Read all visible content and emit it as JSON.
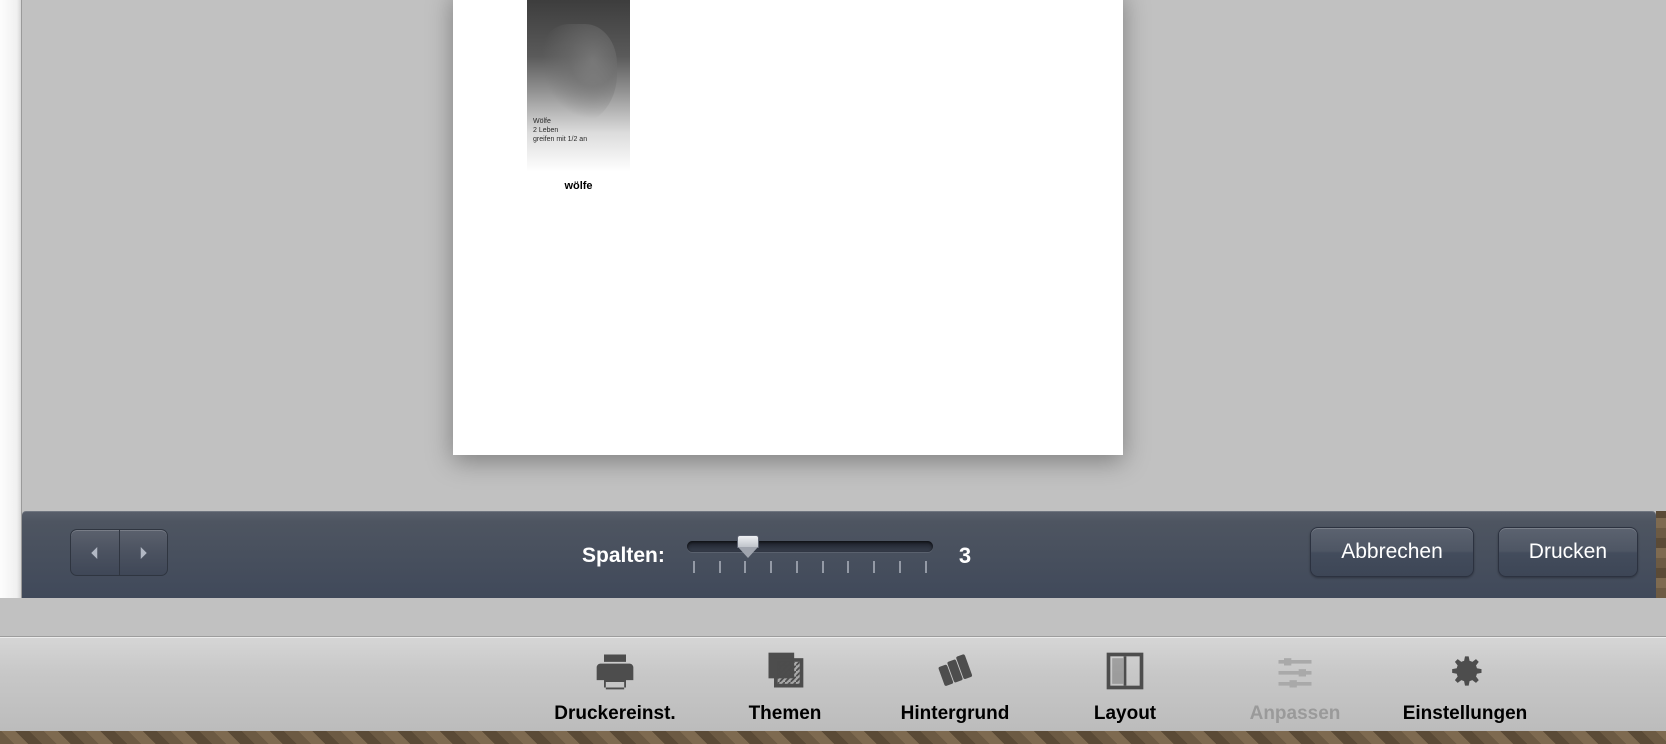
{
  "card": {
    "title": "Wölfe",
    "line2": "2 Leben",
    "line3": "greifen mit 1/2 an",
    "caption": "wölfe"
  },
  "controlbar": {
    "slider_label": "Spalten:",
    "slider_value": "3",
    "slider_ticks": 10,
    "slider_position_pct": 25,
    "cancel_label": "Abbrechen",
    "print_label": "Drucken"
  },
  "toolbar": {
    "items": [
      {
        "key": "printer",
        "label": "Druckereinst.",
        "disabled": false
      },
      {
        "key": "themes",
        "label": "Themen",
        "disabled": false
      },
      {
        "key": "background",
        "label": "Hintergrund",
        "disabled": false
      },
      {
        "key": "layout",
        "label": "Layout",
        "disabled": false
      },
      {
        "key": "adjust",
        "label": "Anpassen",
        "disabled": true
      },
      {
        "key": "settings",
        "label": "Einstellungen",
        "disabled": false
      }
    ]
  }
}
